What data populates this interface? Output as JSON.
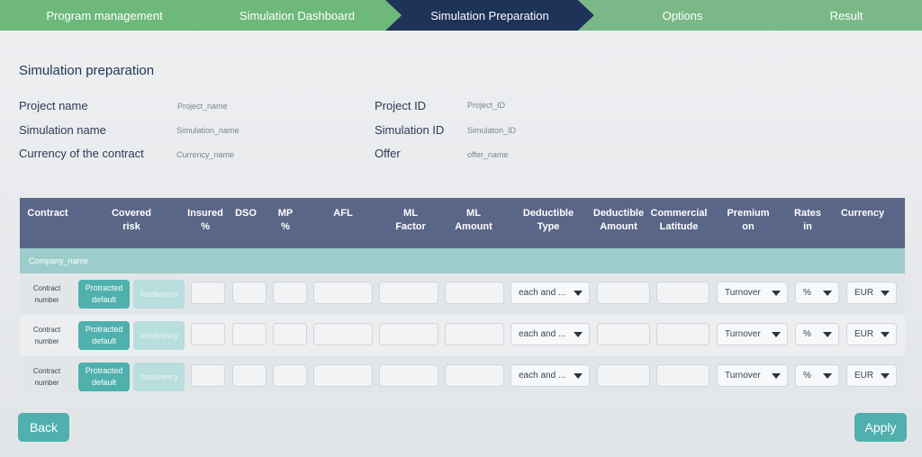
{
  "stepper": {
    "steps": [
      "Program management",
      "Simulation Dashboard",
      "Simulation Preparation",
      "Options",
      "Result"
    ]
  },
  "page": {
    "title": "Simulation preparation"
  },
  "info": {
    "project_name_label": "Project name",
    "project_name_value": "Project_name",
    "simulation_name_label": "Simulation name",
    "simulation_name_value": "Simulation_name",
    "currency_label": "Currency of the contract",
    "currency_value": "Currency_name",
    "project_id_label": "Project ID",
    "project_id_value": "Project_ID",
    "simulation_id_label": "Simulation ID",
    "simulation_id_value": "Simulaton_ID",
    "offer_label": "Offer",
    "offer_value": "offer_name"
  },
  "table": {
    "headers": {
      "contract": "Contract",
      "covered_risk": "Covered\nrisk",
      "insured": "Insured\n%",
      "dso": "DSO",
      "mp": "MP\n%",
      "afl": "AFL",
      "ml_factor": "ML\nFactor",
      "ml_amount": "ML\nAmount",
      "deductible_type": "Deductible\nType",
      "deductible_amount": "Deductible\nAmount",
      "commercial_latitude": "Commercial\nLatitude",
      "premium_on": "Premium\non",
      "rates_in": "Rates\nin",
      "currency": "Currency"
    },
    "company": "Company_name",
    "rows": [
      {
        "contract": "Contract\nnumber",
        "risk_on": "Protracted\ndefault",
        "risk_off": "Insolvency",
        "deductible_type": "each and ...",
        "premium_on": "Turnover",
        "rates_in": "%",
        "currency": "EUR"
      },
      {
        "contract": "Contract\nnumber",
        "risk_on": "Protracted\ndefault",
        "risk_off": "Insolvency",
        "deductible_type": "each and ...",
        "premium_on": "Turnover",
        "rates_in": "%",
        "currency": "EUR"
      },
      {
        "contract": "Contract\nnumber",
        "risk_on": "Protracted\ndefault",
        "risk_off": "Insolvency",
        "deductible_type": "each and ...",
        "premium_on": "Turnover",
        "rates_in": "%",
        "currency": "EUR"
      }
    ]
  },
  "buttons": {
    "back": "Back",
    "apply": "Apply"
  },
  "colors": {
    "step_done": "#6db87a",
    "step_active": "#1d3358",
    "header_bg": "#5a6687",
    "company_bg": "#9ccdcc",
    "accent_teal": "#4fb0ad"
  }
}
